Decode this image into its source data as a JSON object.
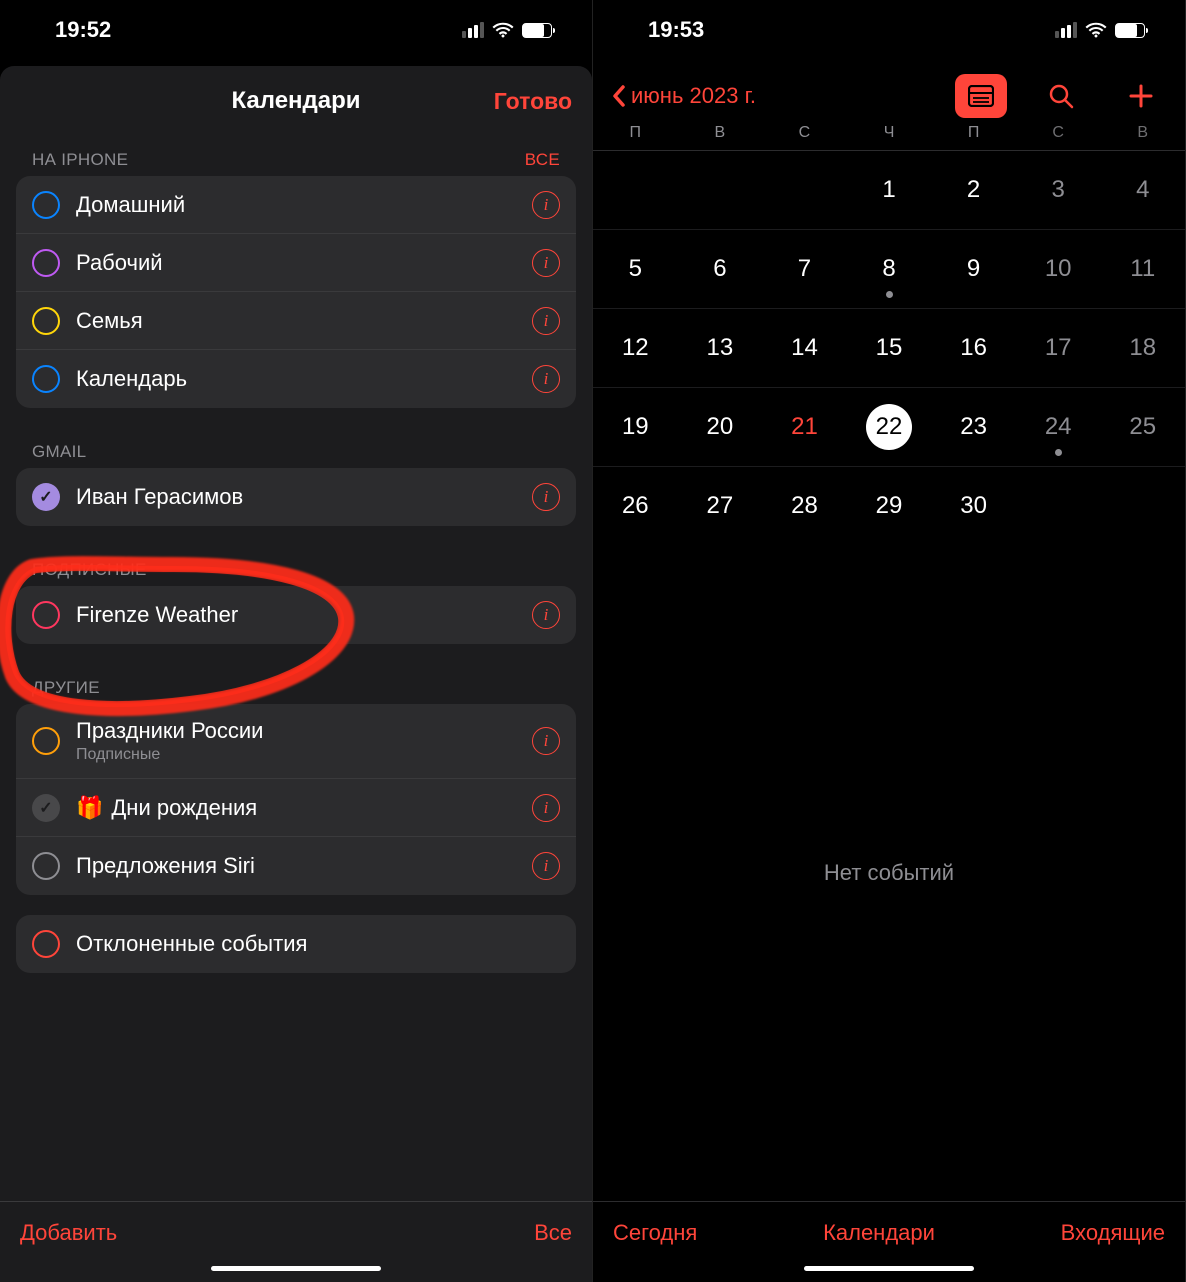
{
  "left": {
    "status": {
      "time": "19:52"
    },
    "header": {
      "title": "Календари",
      "done": "Готово"
    },
    "sections": [
      {
        "title": "НА IPHONE",
        "action": "ВСЕ",
        "items": [
          {
            "label": "Домашний",
            "color": "#0a84ff",
            "checked": false
          },
          {
            "label": "Рабочий",
            "color": "#bf5af2",
            "checked": false
          },
          {
            "label": "Семья",
            "color": "#ffd60a",
            "checked": false
          },
          {
            "label": "Календарь",
            "color": "#0a84ff",
            "checked": false
          }
        ]
      },
      {
        "title": "GMAIL",
        "items": [
          {
            "label": "Иван Герасимов",
            "color": "#a48be0",
            "checked": true
          }
        ]
      },
      {
        "title": "ПОДПИСНЫЕ",
        "items": [
          {
            "label": "Firenze Weather",
            "color": "#ff375f",
            "checked": false
          }
        ]
      },
      {
        "title": "ДРУГИЕ",
        "items": [
          {
            "label": "Праздники России",
            "sub": "Подписные",
            "color": "#ff9f0a",
            "checked": false
          },
          {
            "label": "Дни рождения",
            "color": "#8e8e93",
            "checked": true,
            "gift": true,
            "solid": true
          },
          {
            "label": "Предложения Siri",
            "color": "#8e8e93",
            "checked": false
          }
        ]
      },
      {
        "items": [
          {
            "label": "Отклоненные события",
            "color": "#ff453a",
            "checked": false,
            "no_info": true
          }
        ]
      }
    ],
    "footer": {
      "add": "Добавить",
      "all": "Все"
    }
  },
  "right": {
    "status": {
      "time": "19:53"
    },
    "nav": {
      "back": "июнь 2023 г."
    },
    "weekdays": [
      "П",
      "В",
      "С",
      "Ч",
      "П",
      "С",
      "В"
    ],
    "weeks": [
      [
        null,
        null,
        null,
        1,
        2,
        3,
        4
      ],
      [
        5,
        6,
        7,
        8,
        9,
        10,
        11
      ],
      [
        12,
        13,
        14,
        15,
        16,
        17,
        18
      ],
      [
        19,
        20,
        21,
        22,
        23,
        24,
        25
      ],
      [
        26,
        27,
        28,
        29,
        30,
        null,
        null
      ]
    ],
    "today": 22,
    "holiday": 21,
    "dots": [
      8,
      24
    ],
    "no_events": "Нет событий",
    "toolbar": {
      "today": "Сегодня",
      "calendars": "Календари",
      "inbox": "Входящие"
    }
  }
}
